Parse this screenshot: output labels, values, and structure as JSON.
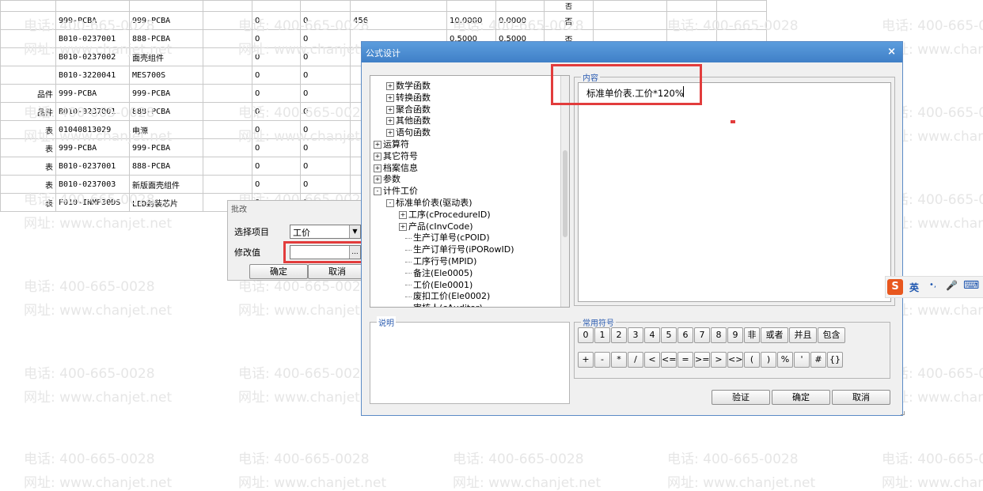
{
  "background_table": {
    "rows": [
      [
        "",
        "999-PCBA",
        "999-PCBA",
        "",
        "0",
        "0",
        "456",
        "10.0000",
        "0.0000",
        "否",
        "",
        "",
        ""
      ],
      [
        "",
        "B010-0237001",
        "888-PCBA",
        "",
        "0",
        "0",
        "",
        "0.5000",
        "0.5000",
        "否",
        "",
        "",
        ""
      ],
      [
        "",
        "B010-0237002",
        "面壳组件",
        "",
        "0",
        "0",
        "",
        "",
        "",
        "",
        "",
        "",
        ""
      ],
      [
        "",
        "B010-3220041",
        "MES700S",
        "",
        "0",
        "0",
        "",
        "",
        "",
        "",
        "",
        "",
        ""
      ],
      [
        "品件",
        "999-PCBA",
        "999-PCBA",
        "",
        "0",
        "0",
        "",
        "",
        "",
        "",
        "",
        "",
        ""
      ],
      [
        "品件",
        "B010-0237001",
        "888-PCBA",
        "",
        "0",
        "0",
        "",
        "",
        "",
        "",
        "",
        "",
        ""
      ],
      [
        "表",
        "01040813029",
        "电源",
        "",
        "0",
        "0",
        "",
        "",
        "",
        "",
        "",
        "",
        ""
      ],
      [
        "表",
        "999-PCBA",
        "999-PCBA",
        "",
        "0",
        "0",
        "",
        "",
        "",
        "",
        "",
        "",
        ""
      ],
      [
        "表",
        "B010-0237001",
        "888-PCBA",
        "",
        "0",
        "0",
        "",
        "",
        "",
        "",
        "",
        "",
        ""
      ],
      [
        "表",
        "B010-0237003",
        "新版面壳组件",
        "",
        "0",
        "0",
        "",
        "",
        "",
        "",
        "",
        "",
        ""
      ],
      [
        "表",
        "F010-INMP30DS",
        "LED封装芯片",
        "",
        "0",
        "0",
        "",
        "",
        "",
        "",
        "",
        "",
        ""
      ]
    ],
    "top_partial_char": "否"
  },
  "watermarks": {
    "phone": "电话: 400-665-0028",
    "site": "网址: www.chanjet.net"
  },
  "batch_dialog": {
    "title": "批改",
    "select_item_label": "选择项目",
    "select_item_value": "工价",
    "modify_value_label": "修改值",
    "modify_value_input": "",
    "ellipsis_label": "...",
    "ok_label": "确定",
    "cancel_label": "取消"
  },
  "formula_dialog": {
    "title": "公式设计",
    "close_glyph": "×",
    "tree": [
      {
        "label": "数学函数",
        "expander": "+"
      },
      {
        "label": "转换函数",
        "expander": "+"
      },
      {
        "label": "聚合函数",
        "expander": "+"
      },
      {
        "label": "其他函数",
        "expander": "+"
      },
      {
        "label": "语句函数",
        "expander": "+"
      },
      {
        "label": "运算符",
        "expander": "+"
      },
      {
        "label": "其它符号",
        "expander": "+"
      },
      {
        "label": "档案信息",
        "expander": "+"
      },
      {
        "label": "参数",
        "expander": "+"
      },
      {
        "label": "计件工价",
        "expander": "-"
      },
      {
        "label": "标准单价表(驱动表)",
        "expander": "-"
      },
      {
        "label": "工序(cProcedureID)",
        "expander": "+"
      },
      {
        "label": "产品(cInvCode)",
        "expander": "+"
      },
      {
        "label": "生产订单号(cPOID)",
        "expander": ""
      },
      {
        "label": "生产订单行号(iPORowID)",
        "expander": ""
      },
      {
        "label": "工序行号(MPID)",
        "expander": ""
      },
      {
        "label": "备注(Ele0005)",
        "expander": ""
      },
      {
        "label": "工价(Ele0001)",
        "expander": ""
      },
      {
        "label": "废扣工价(Ele0002)",
        "expander": ""
      },
      {
        "label": "审核人(cAuditor)",
        "expander": ""
      }
    ],
    "content_label": "内容",
    "content_value": "标准单价表.工价*120%",
    "description_label": "说明",
    "symbols_label": "常用符号",
    "symbols_row1": [
      "0",
      "1",
      "2",
      "3",
      "4",
      "5",
      "6",
      "7",
      "8",
      "9",
      "非",
      "或者",
      "并且",
      "包含"
    ],
    "symbols_row2": [
      "+",
      "-",
      "*",
      "/",
      "<",
      "<=",
      "=",
      ">=",
      ">",
      "<>",
      "(",
      ")",
      "%",
      "'",
      "#",
      "{}"
    ],
    "verify_label": "验证",
    "ok_label": "确定",
    "cancel_label": "取消"
  },
  "ime_bar": {
    "logo": "S",
    "lang": "英",
    "punct": "•,",
    "mic": "🎤",
    "keyboard": "⌨"
  },
  "colors": {
    "highlight_red": "#e23c3c",
    "titlebar_blue": "#4a8bd3",
    "ime_orange": "#e8571e"
  }
}
